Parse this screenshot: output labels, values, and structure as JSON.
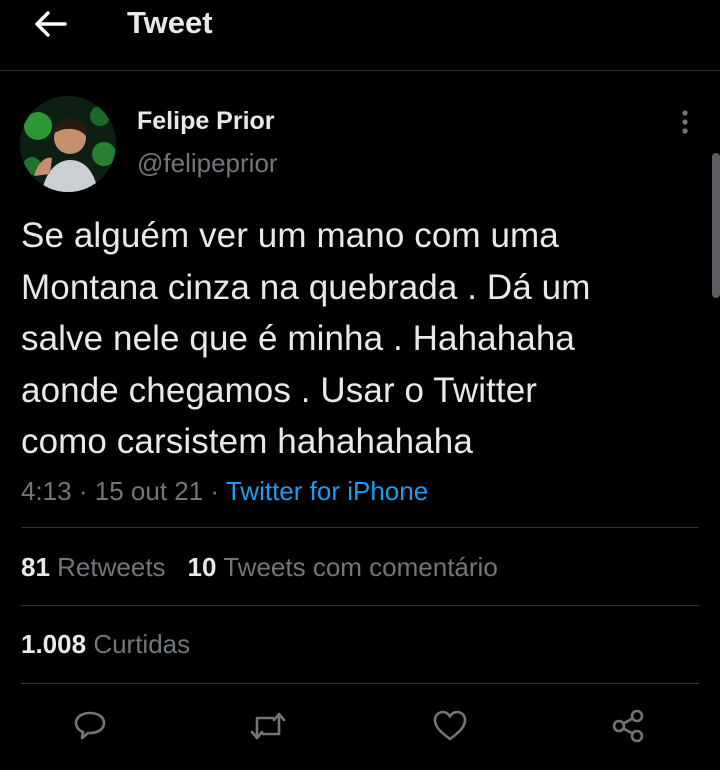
{
  "header": {
    "title": "Tweet",
    "back_icon": "arrow-left-icon"
  },
  "author": {
    "name": "Felipe Prior",
    "handle": "@felipeprior",
    "avatar_icon": "profile-photo"
  },
  "tweet": {
    "text": "Se alguém ver um mano com uma\nMontana cinza na quebrada . Dá um\nsalve nele que é minha . Hahahaha\naonde chegamos . Usar o Twitter\ncomo carsistem hahahahaha",
    "time": "4:13",
    "separator": "·",
    "date": "15 out 21",
    "source": "Twitter for iPhone"
  },
  "stats": {
    "retweets_count": "81",
    "retweets_label": "Retweets",
    "quotes_count": "10",
    "quotes_label": "Tweets com comentário",
    "likes_count": "1.008",
    "likes_label": "Curtidas"
  },
  "actions": [
    "reply-icon",
    "retweet-icon",
    "like-icon",
    "share-icon"
  ],
  "colors": {
    "background": "#000000",
    "text_primary": "#e7e9ea",
    "text_secondary": "#71767b",
    "accent": "#1d9bf0",
    "divider": "#2f3336"
  }
}
